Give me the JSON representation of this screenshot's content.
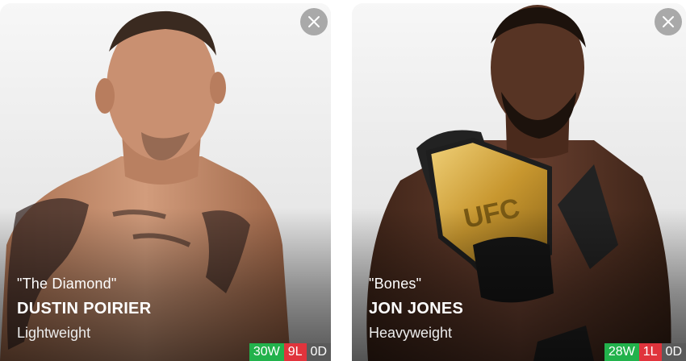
{
  "fighters": [
    {
      "nickname": "\"The Diamond\"",
      "name": "DUSTIN POIRIER",
      "division": "Lightweight",
      "record": {
        "wins": "30W",
        "losses": "9L",
        "draws": "0D"
      }
    },
    {
      "nickname": "\"Bones\"",
      "name": "JON JONES",
      "division": "Heavyweight",
      "record": {
        "wins": "28W",
        "losses": "1L",
        "draws": "0D"
      }
    }
  ],
  "icons": {
    "close": "close-icon"
  },
  "colors": {
    "wins": "#22b24c",
    "losses": "#e0343c",
    "draws": "#5a5a5a",
    "close_button": "#a9a9a9"
  }
}
